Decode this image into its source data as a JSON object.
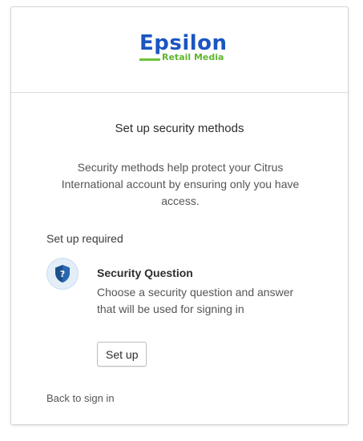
{
  "brand": {
    "logo_main": "Epsilon",
    "logo_sub": "Retail Media",
    "primary_color": "#1a56c2",
    "accent_color": "#5fb62f"
  },
  "page": {
    "title": "Set up security methods",
    "description": "Security methods help protect your Citrus International account by ensuring only you have access.",
    "section_label": "Set up required"
  },
  "methods": [
    {
      "icon": "shield-question-icon",
      "title": "Security Question",
      "description": "Choose a security question and answer that will be used for signing in",
      "button_label": "Set up"
    }
  ],
  "footer": {
    "back_link": "Back to sign in"
  }
}
